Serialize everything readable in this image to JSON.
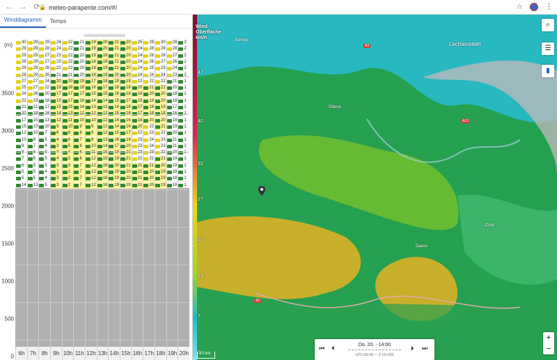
{
  "browser": {
    "url": "meteo-parapente.com/#/",
    "icons": [
      "back-icon",
      "forward-icon",
      "reload-icon",
      "lock-icon",
      "star-icon",
      "profile-avatar",
      "menu-icon"
    ]
  },
  "left": {
    "tabs": [
      {
        "label": "Winddiagramm",
        "active": true
      },
      {
        "label": "Temps",
        "active": false
      }
    ],
    "unit": "(m)",
    "y_labels": [
      "3500",
      "3000",
      "2500",
      "2000",
      "1500",
      "1000",
      "500",
      "0"
    ],
    "x_labels": [
      "6h",
      "7h",
      "8h",
      "9h",
      "10h",
      "11h",
      "12h",
      "13h",
      "14h",
      "15h",
      "16h",
      "17h",
      "18h",
      "19h",
      "20h"
    ]
  },
  "wind_rows": [
    [
      "30",
      "29",
      "29",
      "24",
      "22",
      "21",
      "19",
      "20",
      "21",
      "20",
      "25",
      "29",
      "30",
      "28",
      "3"
    ],
    [
      "29",
      "29",
      "28",
      "24",
      "22",
      "21",
      "19",
      "20",
      "21",
      "20",
      "24",
      "28",
      "29",
      "28",
      "2"
    ],
    [
      "29",
      "29",
      "27",
      "23",
      "22",
      "20",
      "18",
      "19",
      "21",
      "20",
      "24",
      "26",
      "28",
      "27",
      "2"
    ],
    [
      "29",
      "29",
      "27",
      "23",
      "22",
      "20",
      "18",
      "19",
      "21",
      "20",
      "24",
      "26",
      "27",
      "26",
      "2"
    ],
    [
      "29",
      "29",
      "26",
      "22",
      "22",
      "20",
      "18",
      "19",
      "21",
      "20",
      "24",
      "25",
      "25",
      "24",
      "2"
    ],
    [
      "28",
      "29",
      "26",
      "21",
      "21",
      "20",
      "18",
      "19",
      "20",
      "20",
      "24",
      "24",
      "24",
      "23",
      "2"
    ],
    [
      "27",
      "27",
      "24",
      "20",
      "20",
      "19",
      "17",
      "18",
      "19",
      "19",
      "22",
      "22",
      "22",
      "21",
      "1"
    ],
    [
      "25",
      "27",
      "22",
      "19",
      "18",
      "18",
      "16",
      "17",
      "18",
      "18",
      "20",
      "21",
      "21",
      "20",
      "1"
    ],
    [
      "24",
      "26",
      "20",
      "17",
      "17",
      "17",
      "15",
      "15",
      "16",
      "18",
      "18",
      "20",
      "20",
      "18",
      "1"
    ],
    [
      "22",
      "23",
      "18",
      "15",
      "17",
      "16",
      "14",
      "14",
      "15",
      "17",
      "18",
      "19",
      "20",
      "18",
      "1"
    ],
    [
      "21",
      "21",
      "17",
      "15",
      "15",
      "14",
      "13",
      "13",
      "14",
      "16",
      "17",
      "18",
      "19",
      "17",
      "1"
    ],
    [
      "20",
      "18",
      "16",
      "14",
      "13",
      "12",
      "12",
      "12",
      "15",
      "16",
      "17",
      "18",
      "18",
      "16",
      "1"
    ],
    [
      "17",
      "15",
      "13",
      "12",
      "11",
      "10",
      "10",
      "12",
      "14",
      "16",
      "18",
      "20",
      "20",
      "18",
      "1"
    ],
    [
      "15",
      "13",
      "10",
      "9",
      "10",
      "9",
      "9",
      "12",
      "14",
      "16",
      "20",
      "22",
      "21",
      "19",
      "1"
    ],
    [
      "12",
      "10",
      "7",
      "6",
      "8",
      "8",
      "9",
      "12",
      "15",
      "17",
      "22",
      "23",
      "22",
      "20",
      "1"
    ],
    [
      "10",
      "8",
      "5",
      "4",
      "6",
      "7",
      "9",
      "13",
      "16",
      "19",
      "23",
      "24",
      "23",
      "21",
      "1"
    ],
    [
      "9",
      "7",
      "4",
      "3",
      "5",
      "6",
      "10",
      "14",
      "17",
      "20",
      "23",
      "24",
      "23",
      "21",
      "1"
    ],
    [
      "8",
      "6",
      "5",
      "4",
      "4",
      "6",
      "11",
      "15",
      "18",
      "21",
      "23",
      "23",
      "22",
      "20",
      "1"
    ],
    [
      "7",
      "6",
      "5",
      "4",
      "3",
      "6",
      "12",
      "15",
      "19",
      "21",
      "22",
      "22",
      "21",
      "19",
      "1"
    ],
    [
      "6",
      "5",
      "5",
      "3",
      "3",
      "7",
      "12",
      "16",
      "20",
      "21",
      "21",
      "21",
      "20",
      "19",
      "1"
    ],
    [
      "5",
      "5",
      "4",
      "3",
      "2",
      "7",
      "12",
      "16",
      "19",
      "20",
      "21",
      "20",
      "19",
      "18",
      "1"
    ],
    [
      "5",
      "5",
      "4",
      "3",
      "2",
      "7",
      "12",
      "16",
      "19",
      "20",
      "21",
      "20",
      "19",
      "18",
      "1"
    ],
    [
      "14",
      "13",
      "5",
      "3",
      "2",
      "7",
      "12",
      "16",
      "19",
      "20",
      "21",
      "20",
      "19",
      "18",
      "1"
    ]
  ],
  "map": {
    "legend_title": "Wind\nOberfläche\nkm/h",
    "legend_values": [
      "47",
      "40",
      "33",
      "27",
      "20",
      "13",
      "7",
      "0"
    ],
    "places": [
      {
        "name": "Lechtenstein"
      },
      {
        "name": "Glarus"
      },
      {
        "name": "Schwyz"
      },
      {
        "name": "Davos"
      },
      {
        "name": "Chur"
      }
    ],
    "road_labels": [
      "A3",
      "A13",
      "A2"
    ],
    "scale_label": "10 km",
    "buttons": [
      "search-icon",
      "sliders-icon",
      "bar-chart-icon"
    ],
    "zoom_in": "+",
    "zoom_out": "−",
    "time": {
      "date": "Do. 20. - 14:00",
      "sub": "UTC+02:00 — Z 16+18Z",
      "btn_first": "⏮",
      "btn_prev": "⏴",
      "btn_next": "⏵",
      "btn_last": "⏭"
    }
  }
}
